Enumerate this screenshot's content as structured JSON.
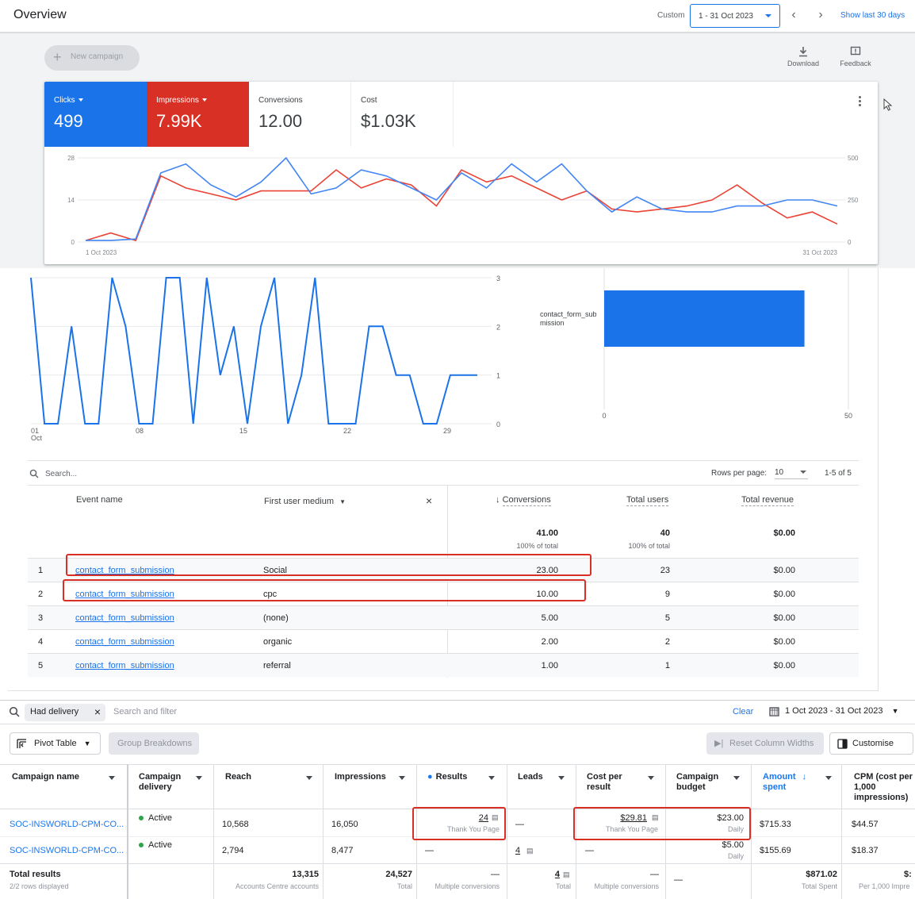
{
  "overview": {
    "title": "Overview",
    "custom_label": "Custom",
    "date_range": "1 - 31 Oct 2023",
    "show_last": "Show last 30 days",
    "new_campaign": "New campaign",
    "download": "Download",
    "feedback": "Feedback",
    "metrics": [
      {
        "label": "Clicks",
        "value": "499",
        "color": "#1a73e8"
      },
      {
        "label": "Impressions",
        "value": "7.99K",
        "color": "#d93025"
      },
      {
        "label": "Conversions",
        "value": "12.00"
      },
      {
        "label": "Cost",
        "value": "$1.03K"
      }
    ]
  },
  "chart_data": [
    {
      "type": "line",
      "x": [
        "1 Oct 2023",
        "2",
        "3",
        "4",
        "5",
        "6",
        "7",
        "8",
        "9",
        "10",
        "11",
        "12",
        "13",
        "14",
        "15",
        "16",
        "17",
        "18",
        "19",
        "20",
        "21",
        "22",
        "23",
        "24",
        "25",
        "26",
        "27",
        "28",
        "29",
        "30",
        "31 Oct 2023"
      ],
      "xtick_labels": [
        "1 Oct 2023",
        "31 Oct 2023"
      ],
      "yticks_left": [
        "28",
        "14",
        "0"
      ],
      "yticks_right": [
        "500",
        "250",
        "0"
      ],
      "ylim_left": [
        0,
        28
      ],
      "ylim_right": [
        0,
        500
      ],
      "series": [
        {
          "name": "Clicks",
          "color": "#4285f4",
          "axis": "left",
          "values": [
            0.5,
            0.5,
            1,
            23,
            26,
            19,
            15,
            20,
            28,
            16,
            18,
            24,
            22,
            18,
            14,
            23,
            18,
            26,
            20,
            26,
            17,
            10,
            15,
            11,
            10,
            10,
            12,
            12,
            14,
            14,
            12
          ]
        },
        {
          "name": "Impressions",
          "color": "#ea4335",
          "axis": "left",
          "values": [
            0.5,
            3,
            0.5,
            22,
            18,
            16,
            14,
            17,
            17,
            17,
            24,
            18,
            21,
            19,
            12,
            24,
            20,
            22,
            18,
            14,
            17,
            11,
            10,
            11,
            12,
            14,
            19,
            13,
            8,
            10,
            6
          ]
        }
      ]
    },
    {
      "type": "line",
      "xtick_labels": [
        "01\nOct",
        "08",
        "15",
        "22",
        "29"
      ],
      "yticks": [
        "3",
        "2",
        "1",
        "0"
      ],
      "ylim": [
        0,
        3
      ],
      "series": [
        {
          "values": [
            3,
            0,
            0,
            2,
            0,
            0,
            3,
            2,
            0,
            0,
            3,
            3,
            0,
            3,
            1,
            2,
            0,
            2,
            3,
            0,
            1,
            3,
            0,
            0,
            0,
            2,
            2,
            1,
            1,
            0,
            0,
            1,
            1,
            1
          ]
        }
      ]
    },
    {
      "type": "bar",
      "orientation": "horizontal",
      "categories": [
        "contact_form_submission"
      ],
      "values": [
        41
      ],
      "xticks": [
        "0",
        "50"
      ],
      "xlim": [
        0,
        50
      ]
    }
  ],
  "ga_table": {
    "search_placeholder": "Search...",
    "rows_per_page_label": "Rows per page:",
    "rows_per_page": "10",
    "page_range": "1-5 of 5",
    "headers": {
      "event_name": "Event name",
      "medium": "First user medium",
      "conversions": "Conversions",
      "total_users": "Total users",
      "total_revenue": "Total revenue"
    },
    "totals": {
      "conversions": "41.00",
      "conversions_pct": "100% of total",
      "users": "40",
      "users_pct": "100% of total",
      "revenue": "$0.00"
    },
    "rows": [
      {
        "n": "1",
        "event": "contact_form_submission",
        "medium": "Social",
        "conversions": "23.00",
        "users": "23",
        "revenue": "$0.00"
      },
      {
        "n": "2",
        "event": "contact_form_submission",
        "medium": "cpc",
        "conversions": "10.00",
        "users": "9",
        "revenue": "$0.00"
      },
      {
        "n": "3",
        "event": "contact_form_submission",
        "medium": "(none)",
        "conversions": "5.00",
        "users": "5",
        "revenue": "$0.00"
      },
      {
        "n": "4",
        "event": "contact_form_submission",
        "medium": "organic",
        "conversions": "2.00",
        "users": "2",
        "revenue": "$0.00"
      },
      {
        "n": "5",
        "event": "contact_form_submission",
        "medium": "referral",
        "conversions": "1.00",
        "users": "1",
        "revenue": "$0.00"
      }
    ]
  },
  "meta": {
    "filter_chip": "Had delivery",
    "filter_placeholder": "Search and filter",
    "clear": "Clear",
    "date_range": "1 Oct 2023 - 31 Oct 2023",
    "pivot_table": "Pivot Table",
    "group_breakdowns": "Group Breakdowns",
    "reset_widths": "Reset Column Widths",
    "customise": "Customise",
    "headers": {
      "campaign_name": "Campaign name",
      "delivery_1": "Campaign",
      "delivery_2": "delivery",
      "reach": "Reach",
      "impressions": "Impressions",
      "results": "Results",
      "leads": "Leads",
      "cpr_1": "Cost per",
      "cpr_2": "result",
      "budget_1": "Campaign",
      "budget_2": "budget",
      "amount_1": "Amount",
      "amount_2": "spent",
      "cpm_1": "CPM (cost per",
      "cpm_2": "1,000",
      "cpm_3": "impressions)"
    },
    "rows": [
      {
        "name": "SOC-INSWORLD-CPM-CO...",
        "delivery": "Active",
        "reach": "10,568",
        "impressions": "16,050",
        "results": "24",
        "results_sub": "Thank You Page",
        "leads": "—",
        "cpr": "$29.81",
        "cpr_sub": "Thank You Page",
        "budget": "$23.00",
        "budget_sub": "Daily",
        "amount": "$715.33",
        "cpm": "$44.57"
      },
      {
        "name": "SOC-INSWORLD-CPM-CO...",
        "delivery": "Active",
        "reach": "2,794",
        "impressions": "8,477",
        "results": "—",
        "results_sub": "",
        "leads": "4",
        "cpr": "—",
        "cpr_sub": "",
        "budget": "$5.00",
        "budget_sub": "Daily",
        "amount": "$155.69",
        "cpm": "$18.37"
      }
    ],
    "totals": {
      "label": "Total results",
      "sub": "2/2 rows displayed",
      "reach": "13,315",
      "reach_sub": "Accounts Centre accounts",
      "impressions": "24,527",
      "impressions_sub": "Total",
      "results": "—",
      "results_sub": "Multiple conversions",
      "leads": "4",
      "leads_sub": "Total",
      "cpr": "—",
      "cpr_sub": "Multiple conversions",
      "budget": "—",
      "amount": "$871.02",
      "amount_sub": "Total Spent",
      "cpm": "$:",
      "cpm_sub": "Per 1,000 Impre"
    }
  }
}
